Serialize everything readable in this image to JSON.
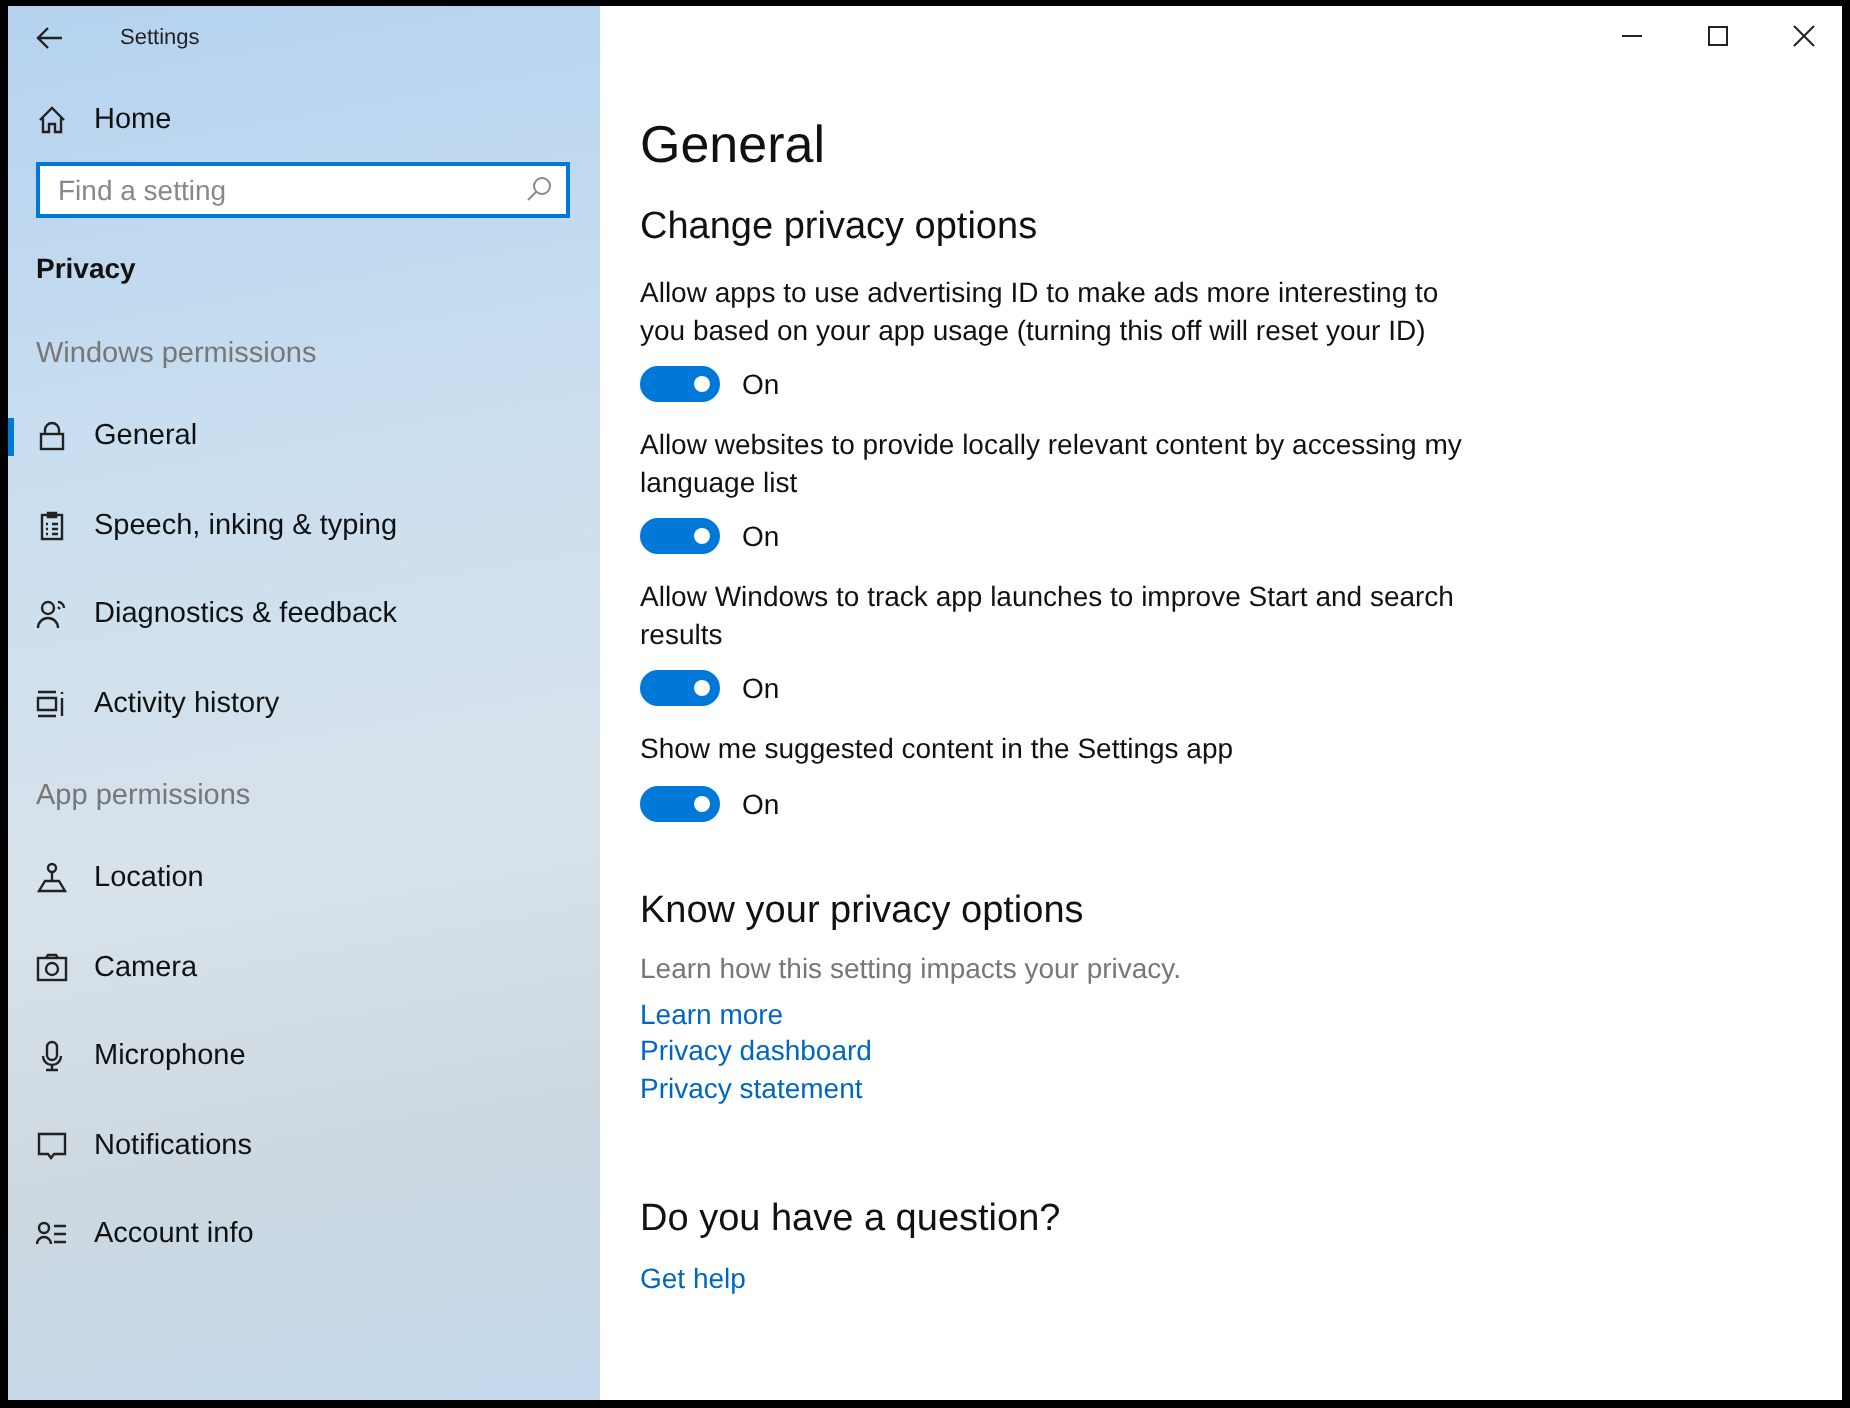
{
  "window": {
    "title": "Settings"
  },
  "sidebar": {
    "home": "Home",
    "search": {
      "placeholder": "Find a setting"
    },
    "category": "Privacy",
    "groups": [
      {
        "heading": "Windows permissions",
        "items": [
          {
            "label": "General",
            "selected": true
          },
          {
            "label": "Speech, inking & typing",
            "selected": false
          },
          {
            "label": "Diagnostics & feedback",
            "selected": false
          },
          {
            "label": "Activity history",
            "selected": false
          }
        ]
      },
      {
        "heading": "App permissions",
        "items": [
          {
            "label": "Location",
            "selected": false
          },
          {
            "label": "Camera",
            "selected": false
          },
          {
            "label": "Microphone",
            "selected": false
          },
          {
            "label": "Notifications",
            "selected": false
          },
          {
            "label": "Account info",
            "selected": false
          }
        ]
      }
    ]
  },
  "page": {
    "title": "General",
    "section": "Change privacy options",
    "settings": [
      {
        "description": "Allow apps to use advertising ID to make ads more interesting to you based on your app usage (turning this off will reset your ID)",
        "on": true,
        "state_label": "On"
      },
      {
        "description": "Allow websites to provide locally relevant content by accessing my language list",
        "on": true,
        "state_label": "On"
      },
      {
        "description": "Allow Windows to track app launches to improve Start and search results",
        "on": true,
        "state_label": "On"
      },
      {
        "description": "Show me suggested content in the Settings app",
        "on": true,
        "state_label": "On"
      }
    ],
    "know": {
      "heading": "Know your privacy options",
      "text": "Learn how this setting impacts your privacy.",
      "links": [
        "Learn more",
        "Privacy dashboard",
        "Privacy statement"
      ]
    },
    "question": {
      "heading": "Do you have a question?",
      "links": [
        "Get help"
      ]
    }
  }
}
